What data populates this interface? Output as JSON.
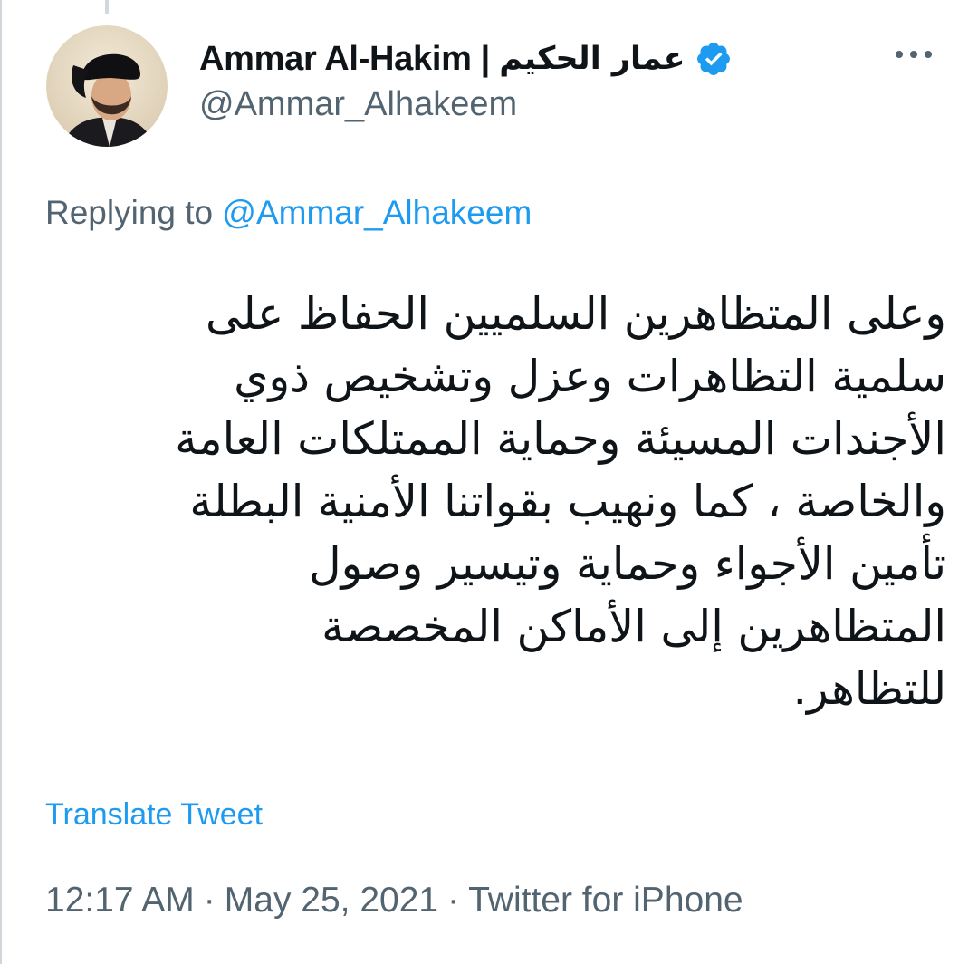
{
  "tweet": {
    "author": {
      "name_en": "Ammar Al-Hakim",
      "separator": "|",
      "name_ar": "عمار الحكيم",
      "handle": "@Ammar_Alhakeem",
      "verified_icon": "verified-badge-icon"
    },
    "more_icon": "more-options-icon",
    "replying": {
      "prefix": "Replying to",
      "mention": "@Ammar_Alhakeem"
    },
    "lines": [
      "وعلى المتظاهرين السلميين الحفاظ على",
      "سلمية التظاهرات وعزل وتشخيص ذوي",
      "الأجندات المسيئة وحماية الممتلكات العامة",
      "والخاصة ، كما ونهيب بقواتنا الأمنية البطلة",
      "تأمين الأجواء وحماية وتيسير وصول",
      "المتظاهرين إلى الأماكن المخصصة",
      "للتظاهر."
    ],
    "translate_label": "Translate Tweet",
    "time": "12:17 AM",
    "date": "May 25, 2021",
    "source": "Twitter for iPhone",
    "meta_separator": "·"
  },
  "colors": {
    "accent": "#1d9bf0",
    "secondary_text": "#536471",
    "primary_text": "#0f1419"
  }
}
